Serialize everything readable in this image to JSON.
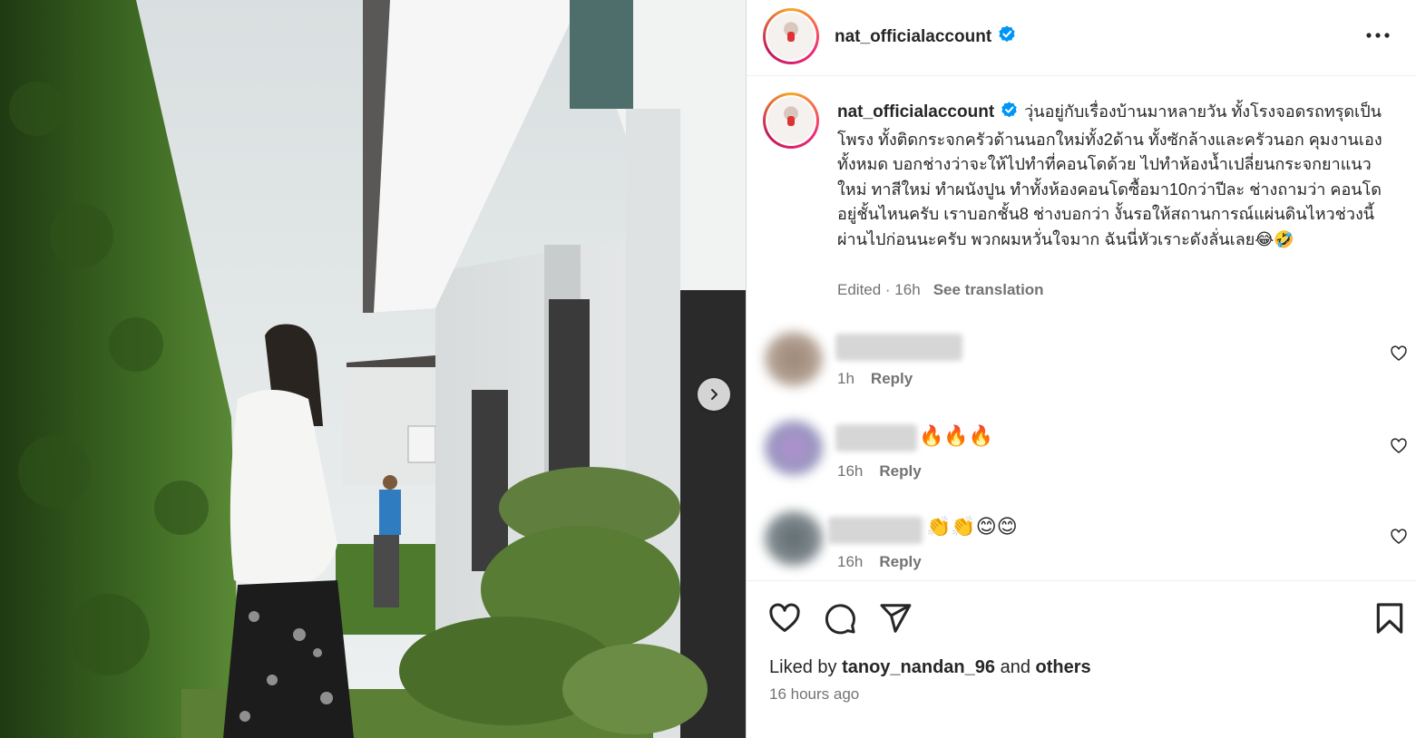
{
  "post": {
    "username": "nat_officialaccount",
    "verified": true,
    "caption": "วุ่นอยู่กับเรื่องบ้านมาหลายวัน ทั้งโรงจอดรถทรุดเป็นโพรง ทั้งติดกระจกครัวด้านนอกใหม่ทั้ง2ด้าน ทั้งซักล้างและครัวนอก คุมงานเองทั้งหมด บอกช่างว่าจะให้ไปทำที่คอนโดด้วย ไปทำห้องน้ำเปลี่ยนกระจกยาแนวใหม่ ทาสีใหม่ ทำผนังปูน ทำทั้งห้องคอนโดซื้อมา10กว่าปีละ ช่างถามว่า คอนโดอยู่ชั้นไหนครับ เราบอกชั้น8 ช่างบอกว่า งั้นรอให้สถานการณ์แผ่นดินไหวช่วงนี้ผ่านไปก่อนนะครับ พวกผมหวั่นใจมาก ฉันนี่หัวเราะดังลั่นเลย😂🤣",
    "edited_time": "Edited · 16h",
    "see_translation": "See translation"
  },
  "comments": [
    {
      "emoji": "",
      "time": "1h",
      "reply": "Reply"
    },
    {
      "emoji": "🔥🔥🔥",
      "time": "16h",
      "reply": "Reply"
    },
    {
      "emoji": "👏👏😊😊",
      "time": "16h",
      "reply": "Reply"
    }
  ],
  "footer": {
    "liked_by_prefix": "Liked by",
    "liked_by_user": "tanoy_nandan_96",
    "and_text": "and",
    "others": "others",
    "time_ago": "16 hours ago"
  },
  "icons": {
    "more": "more-options-icon",
    "like": "heart-icon",
    "comment": "comment-icon",
    "share": "share-icon",
    "save": "bookmark-icon",
    "next": "chevron-right-icon",
    "verified": "verified-badge-icon"
  },
  "colors": {
    "verified": "#0095f6",
    "secondary_text": "#737373",
    "primary_text": "#262626"
  }
}
